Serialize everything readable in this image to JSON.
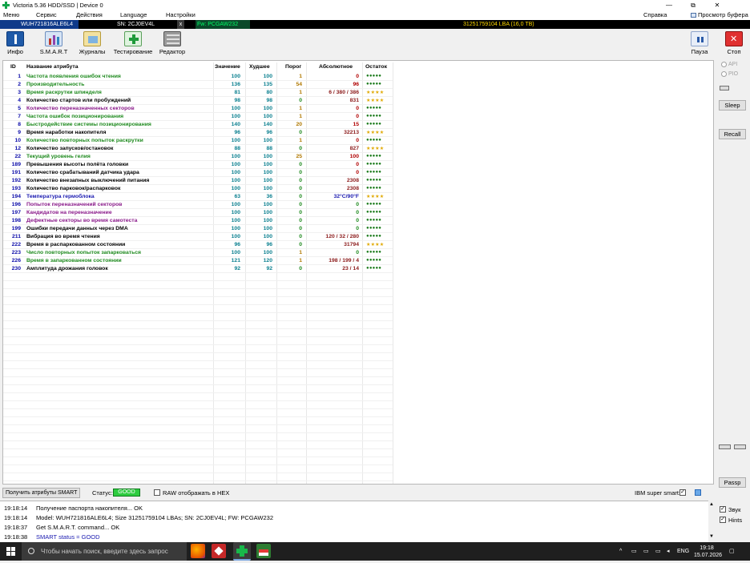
{
  "window": {
    "title": "Victoria 5.36 HDD/SSD | Device 0",
    "minimize": "—",
    "restore": "⧉",
    "close": "✕"
  },
  "menu": {
    "items": [
      "Меню",
      "Сервис",
      "Действия",
      "Language",
      "Настройки"
    ],
    "help": "Справка",
    "buffer": "Просмотр буфера"
  },
  "device": {
    "model": "WUH721816ALE6L4",
    "serial": "SN: 2CJ0EV4L",
    "close": "x",
    "firmware": "Fw: PCGAW232",
    "capacity": "31251759104 LBA (16,0 TB)"
  },
  "toolbar": {
    "info": "Инфо",
    "smart": "S.M.A.R.T",
    "logs": "Журналы",
    "testing": "Тестирование",
    "editor": "Редактор",
    "pause": "Пауза",
    "stop": "Стоп"
  },
  "table": {
    "headers": {
      "id": "ID",
      "name": "Название атрибута",
      "value": "Значение",
      "worst": "Худшее",
      "threshold": "Порог",
      "raw": "Абсолютное",
      "remaining": "Остаток"
    },
    "rows": [
      {
        "id": "1",
        "name": "Частота появления ошибок чтения",
        "nc": "#1e8a1e",
        "value": "100",
        "worst": "100",
        "thr": "1",
        "tc": "#b07800",
        "raw": "0",
        "rc": "#b00000",
        "rem": "●●●●●",
        "remc": "#1a7a1a"
      },
      {
        "id": "2",
        "name": "Производительность",
        "nc": "#1e8a1e",
        "value": "136",
        "worst": "135",
        "thr": "54",
        "tc": "#b07800",
        "raw": "96",
        "rc": "#b00000",
        "rem": "●●●●●",
        "remc": "#1a7a1a"
      },
      {
        "id": "3",
        "name": "Время раскрутки шпинделя",
        "nc": "#1e8a1e",
        "value": "81",
        "worst": "80",
        "thr": "1",
        "tc": "#b07800",
        "raw": "6 / 380 / 386",
        "rc": "#8b1a1a",
        "rem": "★★★★",
        "remc": "#e0a800"
      },
      {
        "id": "4",
        "name": "Количество стартов или пробуждений",
        "nc": "#000000",
        "value": "98",
        "worst": "98",
        "thr": "0",
        "tc": "#1e8a1e",
        "raw": "831",
        "rc": "#8b1a1a",
        "rem": "★★★★",
        "remc": "#e0a800"
      },
      {
        "id": "5",
        "name": "Количество переназначенных секторов",
        "nc": "#8a1a8a",
        "value": "100",
        "worst": "100",
        "thr": "1",
        "tc": "#b07800",
        "raw": "0",
        "rc": "#b00000",
        "rem": "●●●●●",
        "remc": "#1a7a1a"
      },
      {
        "id": "7",
        "name": "Частота ошибок позиционирования",
        "nc": "#1e8a1e",
        "value": "100",
        "worst": "100",
        "thr": "1",
        "tc": "#b07800",
        "raw": "0",
        "rc": "#b00000",
        "rem": "●●●●●",
        "remc": "#1a7a1a"
      },
      {
        "id": "8",
        "name": "Быстродействие системы позиционирования",
        "nc": "#1e8a1e",
        "value": "140",
        "worst": "140",
        "thr": "20",
        "tc": "#b07800",
        "raw": "15",
        "rc": "#b00000",
        "rem": "●●●●●",
        "remc": "#1a7a1a"
      },
      {
        "id": "9",
        "name": "Время наработки накопителя",
        "nc": "#000000",
        "value": "96",
        "worst": "96",
        "thr": "0",
        "tc": "#1e8a1e",
        "raw": "32213",
        "rc": "#8b1a1a",
        "rem": "★★★★",
        "remc": "#e0a800"
      },
      {
        "id": "10",
        "name": "Количество повторных попыток раскрутки",
        "nc": "#1e8a1e",
        "value": "100",
        "worst": "100",
        "thr": "1",
        "tc": "#b07800",
        "raw": "0",
        "rc": "#b00000",
        "rem": "●●●●●",
        "remc": "#1a7a1a"
      },
      {
        "id": "12",
        "name": "Количество запусков/остановок",
        "nc": "#000000",
        "value": "88",
        "worst": "88",
        "thr": "0",
        "tc": "#1e8a1e",
        "raw": "827",
        "rc": "#8b1a1a",
        "rem": "★★★★",
        "remc": "#e0a800"
      },
      {
        "id": "22",
        "name": "Текущий уровень гелия",
        "nc": "#1e8a1e",
        "value": "100",
        "worst": "100",
        "thr": "25",
        "tc": "#b07800",
        "raw": "100",
        "rc": "#b00000",
        "rem": "●●●●●",
        "remc": "#1a7a1a"
      },
      {
        "id": "189",
        "name": "Превышения высоты полёта головки",
        "nc": "#000000",
        "value": "100",
        "worst": "100",
        "thr": "0",
        "tc": "#1e8a1e",
        "raw": "0",
        "rc": "#b00000",
        "rem": "●●●●●",
        "remc": "#1a7a1a"
      },
      {
        "id": "191",
        "name": "Количество срабатываний датчика удара",
        "nc": "#000000",
        "value": "100",
        "worst": "100",
        "thr": "0",
        "tc": "#1e8a1e",
        "raw": "0",
        "rc": "#b00000",
        "rem": "●●●●●",
        "remc": "#1a7a1a"
      },
      {
        "id": "192",
        "name": "Количество внезапных выключений питания",
        "nc": "#000000",
        "value": "100",
        "worst": "100",
        "thr": "0",
        "tc": "#1e8a1e",
        "raw": "2308",
        "rc": "#8b1a1a",
        "rem": "●●●●●",
        "remc": "#1a7a1a"
      },
      {
        "id": "193",
        "name": "Количество парковок/распарковок",
        "nc": "#000000",
        "value": "100",
        "worst": "100",
        "thr": "0",
        "tc": "#1e8a1e",
        "raw": "2308",
        "rc": "#8b1a1a",
        "rem": "●●●●●",
        "remc": "#1a7a1a"
      },
      {
        "id": "194",
        "name": "Температура гермоблока",
        "nc": "#1a1ab0",
        "value": "63",
        "worst": "36",
        "thr": "0",
        "tc": "#1e8a1e",
        "raw": "32°C/90°F",
        "rc": "#1a1ab0",
        "rem": "★★★★",
        "remc": "#e0a800"
      },
      {
        "id": "196",
        "name": "Попыток переназначений секторов",
        "nc": "#8a1a8a",
        "value": "100",
        "worst": "100",
        "thr": "0",
        "tc": "#1e8a1e",
        "raw": "0",
        "rc": "#1e8a1e",
        "rem": "●●●●●",
        "remc": "#1a7a1a"
      },
      {
        "id": "197",
        "name": "Кандидатов на переназначение",
        "nc": "#8a1a8a",
        "value": "100",
        "worst": "100",
        "thr": "0",
        "tc": "#1e8a1e",
        "raw": "0",
        "rc": "#1e8a1e",
        "rem": "●●●●●",
        "remc": "#1a7a1a"
      },
      {
        "id": "198",
        "name": "Дефектные секторы во время самотеста",
        "nc": "#8a1a8a",
        "value": "100",
        "worst": "100",
        "thr": "0",
        "tc": "#1e8a1e",
        "raw": "0",
        "rc": "#1e8a1e",
        "rem": "●●●●●",
        "remc": "#1a7a1a"
      },
      {
        "id": "199",
        "name": "Ошибки передачи данных через DMA",
        "nc": "#000000",
        "value": "100",
        "worst": "100",
        "thr": "0",
        "tc": "#1e8a1e",
        "raw": "0",
        "rc": "#1e8a1e",
        "rem": "●●●●●",
        "remc": "#1a7a1a"
      },
      {
        "id": "211",
        "name": "Вибрация во время чтения",
        "nc": "#000000",
        "value": "100",
        "worst": "100",
        "thr": "0",
        "tc": "#1e8a1e",
        "raw": "120 / 32 / 280",
        "rc": "#8b1a1a",
        "rem": "●●●●●",
        "remc": "#1a7a1a"
      },
      {
        "id": "222",
        "name": "Время в распаркованном состоянии",
        "nc": "#000000",
        "value": "96",
        "worst": "96",
        "thr": "0",
        "tc": "#1e8a1e",
        "raw": "31794",
        "rc": "#8b1a1a",
        "rem": "★★★★",
        "remc": "#e0a800"
      },
      {
        "id": "223",
        "name": "Число повторных попыток запарковаться",
        "nc": "#1e8a1e",
        "value": "100",
        "worst": "100",
        "thr": "1",
        "tc": "#b07800",
        "raw": "0",
        "rc": "#1e8a1e",
        "rem": "●●●●●",
        "remc": "#1a7a1a"
      },
      {
        "id": "226",
        "name": "Время в запаркованном состоянии",
        "nc": "#1e8a1e",
        "value": "121",
        "worst": "120",
        "thr": "1",
        "tc": "#b07800",
        "raw": "198 / 199 / 4",
        "rc": "#8b1a1a",
        "rem": "●●●●●",
        "remc": "#1a7a1a"
      },
      {
        "id": "230",
        "name": "Амплитуда дрожания головок",
        "nc": "#000000",
        "value": "92",
        "worst": "92",
        "thr": "0",
        "tc": "#1e8a1e",
        "raw": "23 / 14",
        "rc": "#8b1a1a",
        "rem": "●●●●●",
        "remc": "#1a7a1a"
      }
    ]
  },
  "right_panel": {
    "api": "API",
    "pio": "PIO",
    "sleep": "Sleep",
    "recall": "Recall",
    "passp": "Passp"
  },
  "status_bar": {
    "get_smart": "Получить атрибуты SMART",
    "status_label": "Статус:",
    "status_value": "GOOD",
    "raw_hex": "RAW отображать в HEX",
    "ibm_smart": "IBM super smart:"
  },
  "log": [
    {
      "time": "19:18:14",
      "text": "Получение паспорта накопителя... OK",
      "color": "#000000"
    },
    {
      "time": "19:18:14",
      "text": "Model: WUH721816ALE6L4; Size 31251759104 LBAs; SN: 2CJ0EV4L; FW: PCGAW232",
      "color": "#000000"
    },
    {
      "time": "19:18:37",
      "text": "Get S.M.A.R.T. command... OK",
      "color": "#000000"
    },
    {
      "time": "19:18:38",
      "text": "SMART status = GOOD",
      "color": "#1a1ab0"
    }
  ],
  "log_options": {
    "sound": "Звук",
    "hints": "Hints"
  },
  "taskbar": {
    "search_placeholder": "Чтобы начать поиск, введите здесь запрос",
    "lang": "ENG",
    "time": "19:18",
    "date": "15.07.2026"
  }
}
